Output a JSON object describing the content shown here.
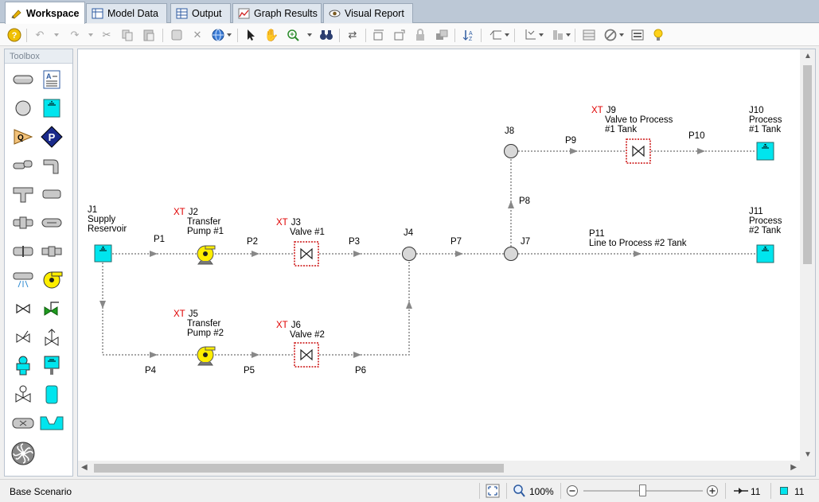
{
  "tabs": [
    {
      "label": "Workspace",
      "icon": "workspace-icon",
      "active": true
    },
    {
      "label": "Model Data",
      "icon": "model-data-icon"
    },
    {
      "label": "Output",
      "icon": "output-icon"
    },
    {
      "label": "Graph Results",
      "icon": "graph-icon"
    },
    {
      "label": "Visual Report",
      "icon": "eye-icon"
    }
  ],
  "toolbox": {
    "title": "Toolbox",
    "tools": [
      "pipe-tool",
      "annotation-tool",
      "branch-tool",
      "reservoir-tool",
      "assigned-flow-tool",
      "pump-tool",
      "bend-tool",
      "elbow-tool",
      "tee-tool",
      "area-change-tool",
      "screen-tool",
      "heat-exchanger-tool",
      "orifice-tool",
      "check-valve-tool",
      "spray-discharge-tool",
      "volume-balance-tool",
      "valve-tool",
      "control-valve-tool",
      "relief-valve-tool",
      "three-way-valve-tool",
      "vacuum-breaker-tool",
      "gas-accumulator-tool",
      "pressure-valve-tool",
      "liquid-accumulator-tool",
      "dead-end-tool",
      "weir-tool",
      "turbine-tool"
    ]
  },
  "diagram": {
    "nodes": {
      "j1": {
        "id": "J1",
        "name": "Supply\nReservoir",
        "xt": false
      },
      "j2": {
        "id": "J2",
        "name": "Transfer\nPump #1",
        "xt": true
      },
      "j3": {
        "id": "J3",
        "name": "Valve #1",
        "xt": true
      },
      "j4": {
        "id": "J4",
        "name": "",
        "xt": false
      },
      "j5": {
        "id": "J5",
        "name": "Transfer\nPump #2",
        "xt": true
      },
      "j6": {
        "id": "J6",
        "name": "Valve #2",
        "xt": true
      },
      "j7": {
        "id": "J7",
        "name": "",
        "xt": false
      },
      "j8": {
        "id": "J8",
        "name": "",
        "xt": false
      },
      "j9": {
        "id": "J9",
        "name": "Valve to Process\n#1 Tank",
        "xt": true
      },
      "j10": {
        "id": "J10",
        "name": "Process\n#1 Tank",
        "xt": false
      },
      "j11": {
        "id": "J11",
        "name": "Process\n#2 Tank",
        "xt": false
      }
    },
    "xt_label": "XT",
    "pipes": {
      "p1": "P1",
      "p2": "P2",
      "p3": "P3",
      "p4": "P4",
      "p5": "P5",
      "p6": "P6",
      "p7": "P7",
      "p8": "P8",
      "p9": "P9",
      "p10": "P10",
      "p11": "P11",
      "p11_name": "Line to Process #2 Tank"
    }
  },
  "status": {
    "scenario": "Base Scenario",
    "zoom": "100%",
    "zoom_level": 0.5,
    "pipe_count": "11",
    "junction_count": "11"
  },
  "colors": {
    "tank": "#00e5ee",
    "pump": "#ffee00",
    "node": "#d8d8d8",
    "xt": "#e00000",
    "pipe": "#888888"
  }
}
